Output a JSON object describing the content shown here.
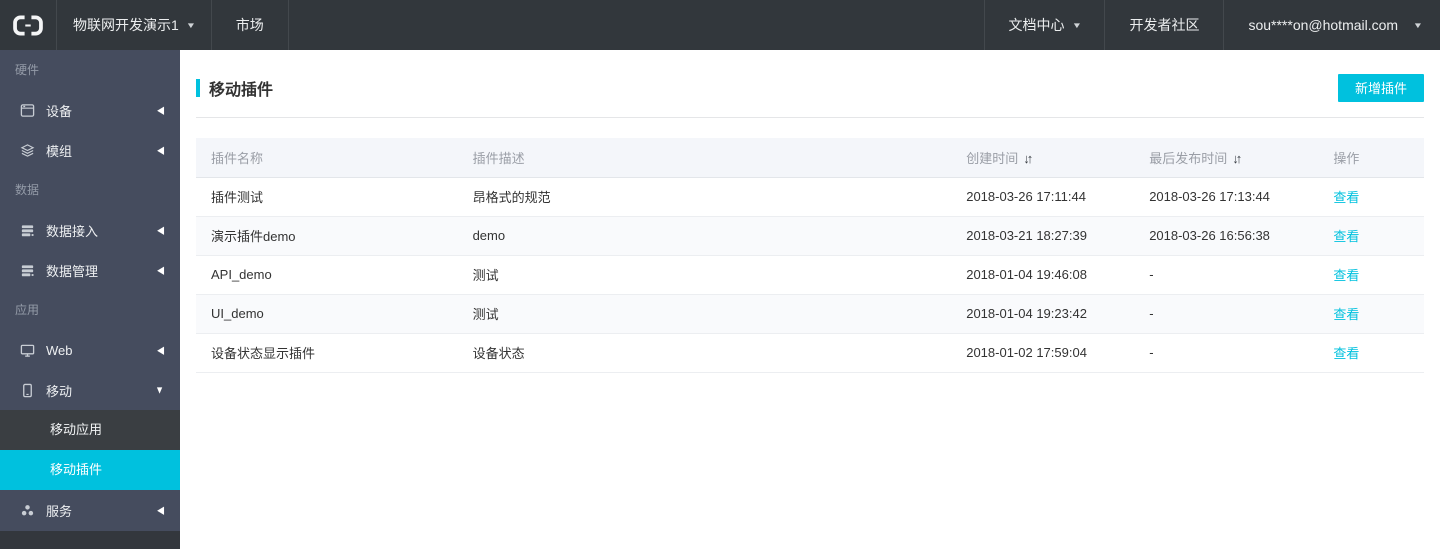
{
  "colors": {
    "accent": "#00c1de",
    "navbar_bg": "#32373c",
    "sidebar_bg": "#454c5e",
    "sub_item_bg": "#3a3e42",
    "active_item_bg": "#00c1de",
    "link": "#00c1de"
  },
  "icons": {
    "sort": "↓↑",
    "caret_down": "▼",
    "collapsed": "◀",
    "expanded": "▼"
  },
  "navbar": {
    "project_menu": "物联网开发演示1",
    "market": "市场",
    "docs_center": "文档中心",
    "dev_community": "开发者社区",
    "account": "sou****on@hotmail.com"
  },
  "sidebar": {
    "section_hardware": "硬件",
    "device": "设备",
    "module": "模组",
    "section_data": "数据",
    "data_access": "数据接入",
    "data_mgmt": "数据管理",
    "section_app": "应用",
    "web": "Web",
    "mobile": "移动",
    "mobile_app": "移动应用",
    "mobile_plugin": "移动插件",
    "service": "服务"
  },
  "main": {
    "title": "移动插件",
    "add_button": "新增插件",
    "table": {
      "headers": {
        "name": "插件名称",
        "desc": "插件描述",
        "created": "创建时间",
        "published": "最后发布时间",
        "actions": "操作"
      },
      "rows": [
        {
          "name": "插件测试",
          "desc": "昂格式的规范",
          "created": "2018-03-26 17:11:44",
          "published": "2018-03-26 17:13:44",
          "action": "查看"
        },
        {
          "name": "演示插件demo",
          "desc": "demo",
          "created": "2018-03-21 18:27:39",
          "published": "2018-03-26 16:56:38",
          "action": "查看"
        },
        {
          "name": "API_demo",
          "desc": "测试",
          "created": "2018-01-04 19:46:08",
          "published": "-",
          "action": "查看"
        },
        {
          "name": "UI_demo",
          "desc": "测试",
          "created": "2018-01-04 19:23:42",
          "published": "-",
          "action": "查看"
        },
        {
          "name": "设备状态显示插件",
          "desc": "设备状态",
          "created": "2018-01-02 17:59:04",
          "published": "-",
          "action": "查看"
        }
      ]
    }
  }
}
